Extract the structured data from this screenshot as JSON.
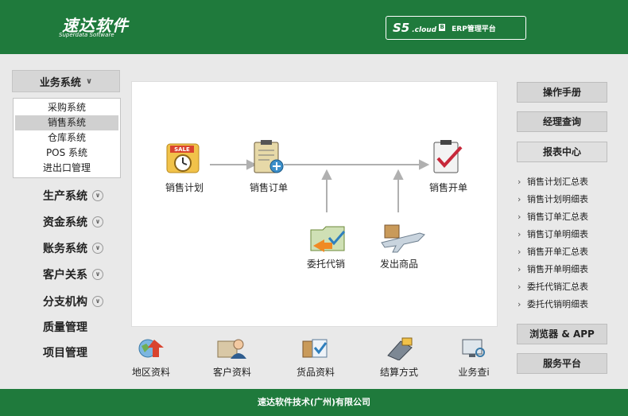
{
  "header": {
    "logo_cn": "速达软件",
    "logo_en": "Superdata Software",
    "platform_s5": "S5",
    "platform_cloud": ".cloud",
    "platform_badge": "B",
    "platform_erp": "ERP管理平台"
  },
  "sidebar": {
    "head_label": "业务系统",
    "sub_items": [
      "采购系统",
      "销售系统",
      "仓库系统",
      "POS 系统",
      "进出口管理"
    ],
    "selected_sub_index": 1,
    "items": [
      "生产系统",
      "资金系统",
      "账务系统",
      "客户关系",
      "分支机构",
      "质量管理",
      "项目管理"
    ]
  },
  "flow": {
    "sales_plan": "销售计划",
    "sales_order": "销售订单",
    "sales_invoice": "销售开单",
    "consign": "委托代销",
    "ship": "发出商品",
    "sale_badge": "SALE"
  },
  "right": {
    "manual": "操作手册",
    "manager_query": "经理查询",
    "report_center": "报表中心",
    "reports": [
      "销售计划汇总表",
      "销售计划明细表",
      "销售订单汇总表",
      "销售订单明细表",
      "销售开单汇总表",
      "销售开单明细表",
      "委托代销汇总表",
      "委托代销明细表"
    ],
    "browser_app": "浏览器 & APP",
    "service": "服务平台"
  },
  "bottom": [
    "地区资料",
    "客户资料",
    "货品资料",
    "结算方式",
    "业务查i"
  ],
  "footer": "速达软件技术(广州)有限公司",
  "colors": {
    "brand_green": "#1f7a3c",
    "button_gray": "#d6d6d6"
  }
}
